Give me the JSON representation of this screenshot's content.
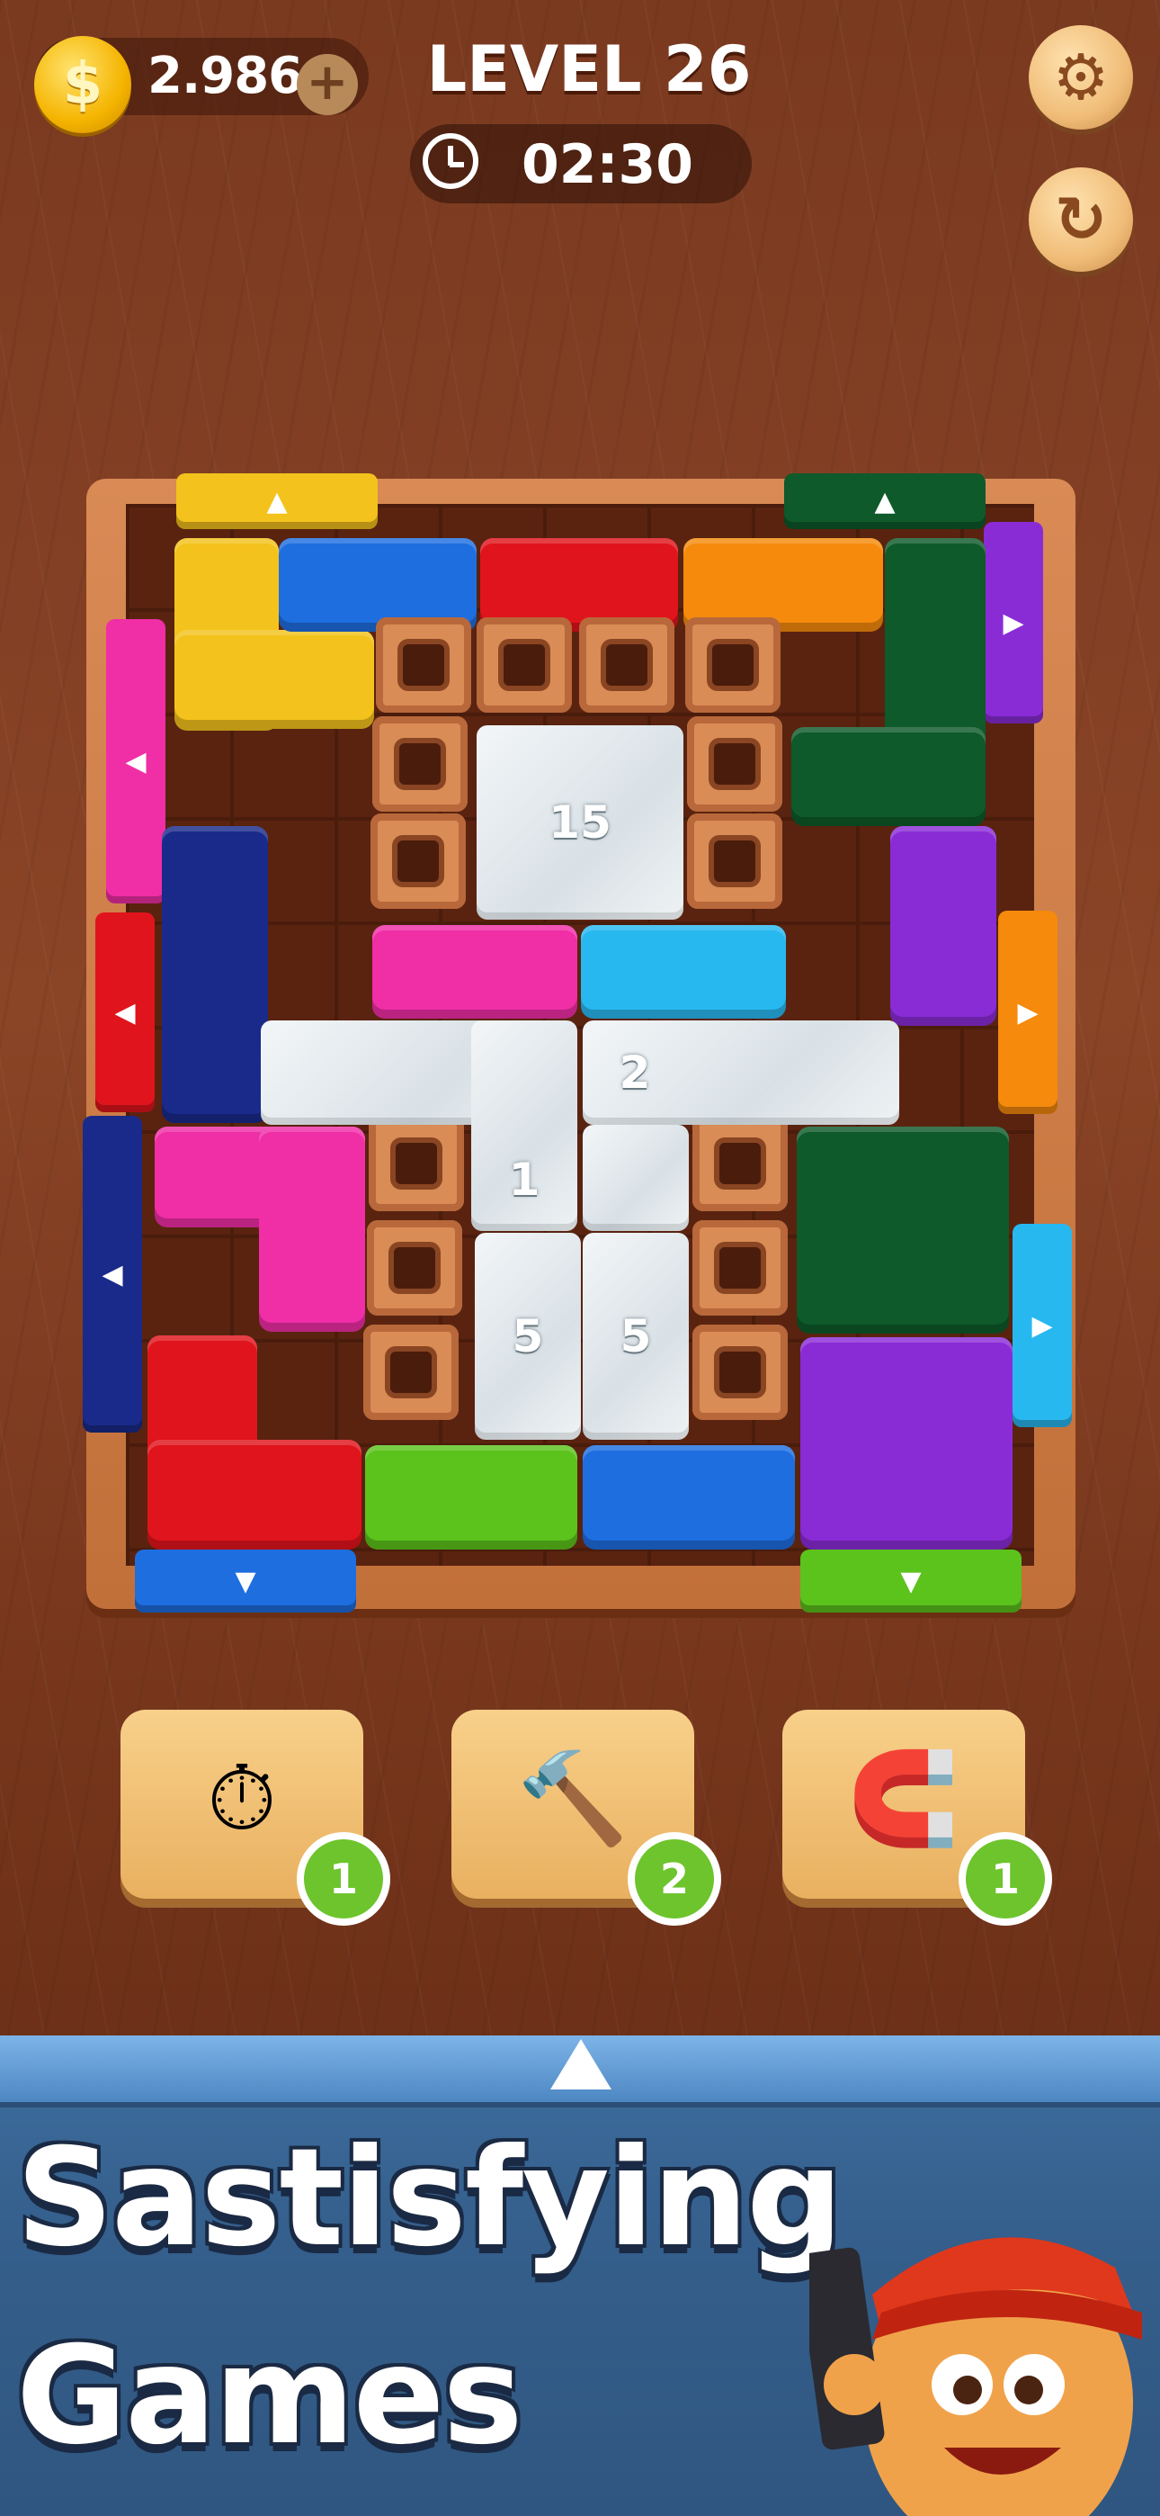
{
  "hud": {
    "coins": "2.986",
    "level": "LEVEL 26",
    "timer": "02:30",
    "settings_icon": "gear-icon",
    "restart_icon": "restart-icon"
  },
  "board": {
    "marble_counts": [
      "15",
      "2",
      "1",
      "5",
      "5"
    ]
  },
  "powerups": [
    {
      "icon": "freeze-clock-icon",
      "count": "1"
    },
    {
      "icon": "hammer-icon",
      "count": "2"
    },
    {
      "icon": "magnet-icon",
      "count": "1"
    }
  ],
  "banner": {
    "line1": "Sastisfying",
    "line2": "Games"
  },
  "colors": {
    "yellow": "#f3c21c",
    "blue": "#1e6ee0",
    "red": "#e0141c",
    "orange": "#f58a0c",
    "dark_green": "#0e5a2a",
    "purple": "#8a2cd6",
    "pink": "#f02ea6",
    "navy": "#1a2a8a",
    "cyan": "#28b8f0",
    "lime": "#5cc21c"
  }
}
